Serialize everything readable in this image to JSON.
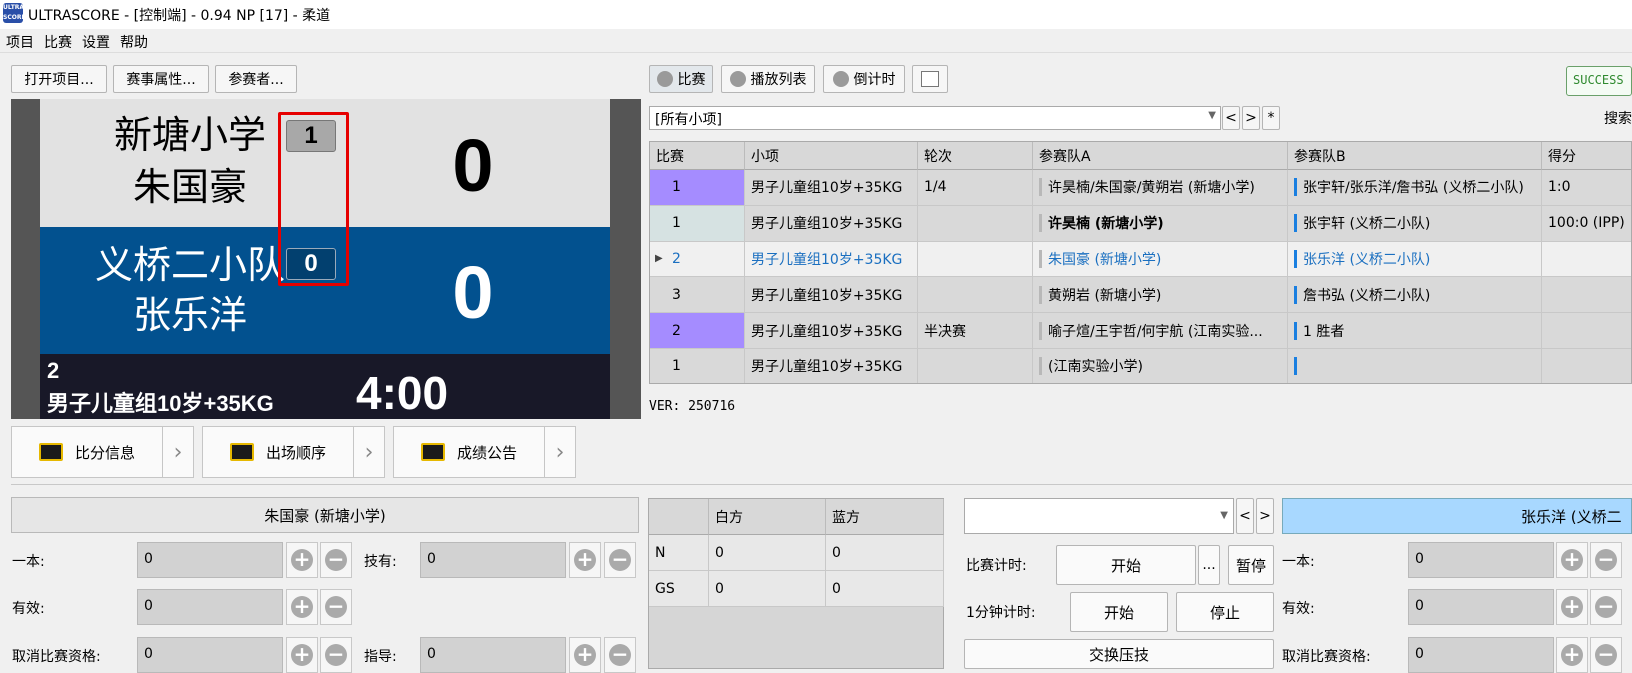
{
  "window": {
    "title": "ULTRASCORE - [控制端] - 0.94 NP [17] - 柔道",
    "icon_text": "ULTRA SCORE"
  },
  "menu": [
    "项目",
    "比赛",
    "设置",
    "帮助"
  ],
  "toolbar_left": [
    "打开项目...",
    "赛事属性...",
    "参赛者..."
  ],
  "toolbar_right": {
    "match": "比赛",
    "playlist": "播放列表",
    "countdown": "倒计时",
    "status": "SUCCESS"
  },
  "scoreboard": {
    "white": {
      "team": "新塘小学",
      "name": "朱国豪",
      "penalty": "1",
      "score": "0"
    },
    "blue": {
      "team": "义桥二小队",
      "name": "张乐洋",
      "penalty": "0",
      "score": "0"
    },
    "match_no": "2",
    "category": "男子儿童组10岁+35KG",
    "timer": "4:00"
  },
  "screen_buttons": [
    "比分信息",
    "出场顺序",
    "成绩公告"
  ],
  "filter": {
    "value": "[所有小项]",
    "prev": "<",
    "next": ">",
    "star": "*",
    "search_label": "搜索"
  },
  "table": {
    "headers": [
      "比赛",
      "小项",
      "轮次",
      "参赛队A",
      "参赛队B",
      "得分"
    ],
    "rows": [
      {
        "match": "1",
        "event": "男子儿童组10岁+35KG",
        "round": "1/4",
        "a": "许昊楠/朱国豪/黄朔岩 (新塘小学)",
        "b": "张宇轩/张乐洋/詹书弘 (义桥二小队)",
        "score": "1:0"
      },
      {
        "match": "1",
        "event": "男子儿童组10岁+35KG",
        "round": "",
        "a": "许昊楠 (新塘小学)",
        "b": "张宇轩 (义桥二小队)",
        "score": "100:0 (IPP)"
      },
      {
        "match": "2",
        "event": "男子儿童组10岁+35KG",
        "round": "",
        "a": "朱国豪 (新塘小学)",
        "b": "张乐洋 (义桥二小队)",
        "score": ""
      },
      {
        "match": "3",
        "event": "男子儿童组10岁+35KG",
        "round": "",
        "a": "黄朔岩 (新塘小学)",
        "b": "詹书弘 (义桥二小队)",
        "score": ""
      },
      {
        "match": "2",
        "event": "男子儿童组10岁+35KG",
        "round": "半决赛",
        "a": "喻子煊/王宇哲/何宇航 (江南实验...",
        "b": "1 胜者",
        "score": ""
      },
      {
        "match": "1",
        "event": "男子儿童组10岁+35KG",
        "round": "",
        "a": "(江南实验小学)",
        "b": "",
        "score": ""
      }
    ]
  },
  "version": "VER: 250716",
  "white_panel": {
    "name": "朱国豪 (新塘小学)",
    "ippon_label": "一本:",
    "ippon": "0",
    "waza_label": "技有:",
    "waza": "0",
    "yuko_label": "有效:",
    "yuko": "0",
    "hansoku_label": "取消比赛资格:",
    "hansoku": "0",
    "shido_label": "指导:",
    "shido": "0"
  },
  "mini_table": {
    "headers": [
      "",
      "白方",
      "蓝方"
    ],
    "rows": [
      [
        "N",
        "0",
        "0"
      ],
      [
        "GS",
        "0",
        "0"
      ]
    ]
  },
  "timer_panel": {
    "match_timer_label": "比赛计时:",
    "start": "开始",
    "more": "...",
    "pause": "暂停",
    "one_min_label": "1分钟计时:",
    "start2": "开始",
    "stop": "停止",
    "osaekomi": "交换压技",
    "prev": "<",
    "next": ">"
  },
  "blue_panel": {
    "name": "张乐洋 (义桥二",
    "ippon_label": "一本:",
    "ippon": "0",
    "yuko_label": "有效:",
    "yuko": "0",
    "hansoku_label": "取消比赛资格:",
    "hansoku": "0"
  },
  "colors": {
    "blue": "#02518f",
    "purple": "#a58cff",
    "link": "#1a6fc0",
    "highlight": "#e60000",
    "blue_name_bg": "#a8d8ff"
  }
}
